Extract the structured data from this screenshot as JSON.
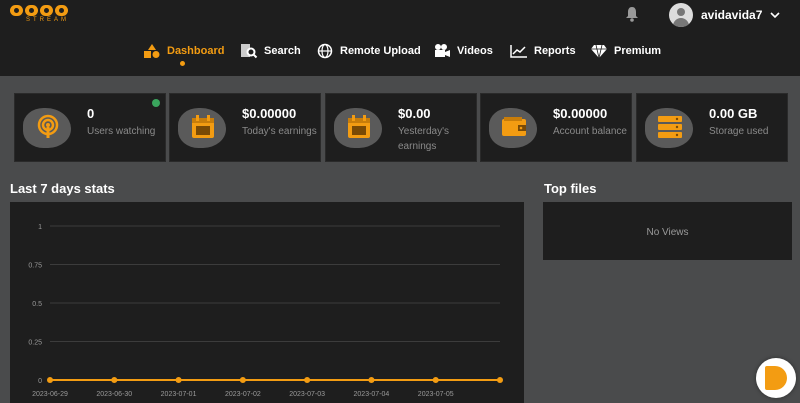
{
  "brand": {
    "logo_text": "DOOD",
    "logo_sub": "STREAM",
    "accent": "#f39c12"
  },
  "header": {
    "username": "avidavida7",
    "bell_icon": "bell-icon",
    "chevron_icon": "chevron-down-icon"
  },
  "nav": [
    {
      "label": "Dashboard",
      "icon": "dashboard-icon",
      "active": true
    },
    {
      "label": "Search",
      "icon": "search-icon",
      "active": false
    },
    {
      "label": "Remote Upload",
      "icon": "globe-icon",
      "active": false
    },
    {
      "label": "Videos",
      "icon": "video-camera-icon",
      "active": false
    },
    {
      "label": "Reports",
      "icon": "line-chart-icon",
      "active": false
    },
    {
      "label": "Premium",
      "icon": "diamond-icon",
      "active": false
    }
  ],
  "stats": [
    {
      "value": "0",
      "label": "Users watching",
      "icon": "podcast-icon"
    },
    {
      "value": "$0.00000",
      "label": "Today's earnings",
      "icon": "calendar-icon"
    },
    {
      "value": "$0.00",
      "label": "Yesterday's earnings",
      "icon": "calendar-icon"
    },
    {
      "value": "$0.00000",
      "label": "Account balance",
      "icon": "wallet-icon"
    },
    {
      "value": "0.00 GB",
      "label": "Storage used",
      "icon": "server-icon"
    }
  ],
  "sections": {
    "stats_title": "Last 7 days stats",
    "top_files_title": "Top files",
    "no_views": "No Views"
  },
  "chart_data": {
    "type": "line",
    "categories": [
      "2023-06-29",
      "2023-06-30",
      "2023-07-01",
      "2023-07-02",
      "2023-07-03",
      "2023-07-04",
      "2023-07-05",
      ""
    ],
    "yticks": [
      "1",
      "0.75",
      "0.5",
      "0.25",
      "0"
    ],
    "series": [
      {
        "values": [
          0,
          0,
          0,
          0,
          0,
          0,
          0,
          0
        ]
      }
    ],
    "ylim": [
      0,
      1
    ],
    "grid": true,
    "color": "#f39c12"
  }
}
